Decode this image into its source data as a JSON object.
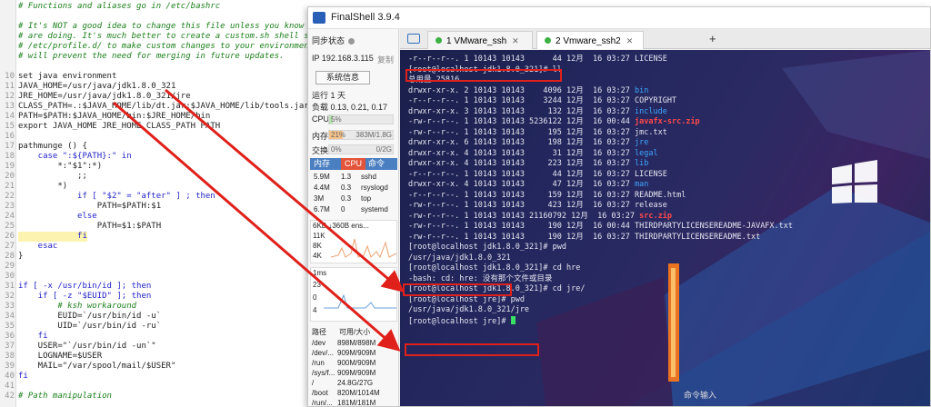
{
  "editor": {
    "lines": [
      {
        "n": "",
        "text": "# Functions and aliases go in /etc/bashrc",
        "cls": "comment"
      },
      {
        "n": "",
        "text": "",
        "cls": ""
      },
      {
        "n": "",
        "text": "# It's NOT a good idea to change this file unless you know what y",
        "cls": "comment"
      },
      {
        "n": "",
        "text": "# are doing. It's much better to create a custom.sh shell script",
        "cls": "comment"
      },
      {
        "n": "",
        "text": "# /etc/profile.d/ to make custom changes to your environment, as",
        "cls": "comment"
      },
      {
        "n": "",
        "text": "# will prevent the need for merging in future updates.",
        "cls": "comment"
      },
      {
        "n": "",
        "text": "",
        "cls": ""
      },
      {
        "n": "10",
        "text": "set java environment",
        "cls": ""
      },
      {
        "n": "11",
        "text": "JAVA_HOME=/usr/java/jdk1.8.0_321",
        "cls": ""
      },
      {
        "n": "12",
        "text": "JRE_HOME=/usr/java/jdk1.8.0_321/jre",
        "cls": ""
      },
      {
        "n": "13",
        "text": "CLASS_PATH=.:$JAVA_HOME/lib/dt.jar:$JAVA_HOME/lib/tools.jar:$JRE_",
        "cls": ""
      },
      {
        "n": "14",
        "text": "PATH=$PATH:$JAVA_HOME/bin:$JRE_HOME/bin",
        "cls": ""
      },
      {
        "n": "15",
        "text": "export JAVA_HOME JRE_HOME CLASS_PATH PATH",
        "cls": ""
      },
      {
        "n": "16",
        "text": "",
        "cls": ""
      },
      {
        "n": "17",
        "text": "pathmunge () {",
        "cls": ""
      },
      {
        "n": "18",
        "text": "    case \":${PATH}:\" in",
        "cls": "kw"
      },
      {
        "n": "19",
        "text": "        *:\"$1\":*)",
        "cls": ""
      },
      {
        "n": "20",
        "text": "            ;;",
        "cls": ""
      },
      {
        "n": "21",
        "text": "        *)",
        "cls": ""
      },
      {
        "n": "22",
        "text": "            if [ \"$2\" = \"after\" ] ; then",
        "cls": "kw"
      },
      {
        "n": "23",
        "text": "                PATH=$PATH:$1",
        "cls": ""
      },
      {
        "n": "24",
        "text": "            else",
        "cls": "kw"
      },
      {
        "n": "25",
        "text": "                PATH=$1:$PATH",
        "cls": ""
      },
      {
        "n": "26",
        "text": "            fi",
        "cls": "kw hl"
      },
      {
        "n": "27",
        "text": "    esac",
        "cls": "kw"
      },
      {
        "n": "28",
        "text": "}",
        "cls": ""
      },
      {
        "n": "29",
        "text": "",
        "cls": ""
      },
      {
        "n": "30",
        "text": "",
        "cls": ""
      },
      {
        "n": "31",
        "text": "if [ -x /usr/bin/id ]; then",
        "cls": "kw"
      },
      {
        "n": "32",
        "text": "    if [ -z \"$EUID\" ]; then",
        "cls": "kw"
      },
      {
        "n": "33",
        "text": "        # ksh workaround",
        "cls": "comment"
      },
      {
        "n": "34",
        "text": "        EUID=`/usr/bin/id -u`",
        "cls": ""
      },
      {
        "n": "35",
        "text": "        UID=`/usr/bin/id -ru`",
        "cls": ""
      },
      {
        "n": "36",
        "text": "    fi",
        "cls": "kw"
      },
      {
        "n": "37",
        "text": "    USER=\"`/usr/bin/id -un`\"",
        "cls": ""
      },
      {
        "n": "38",
        "text": "    LOGNAME=$USER",
        "cls": ""
      },
      {
        "n": "39",
        "text": "    MAIL=\"/var/spool/mail/$USER\"",
        "cls": ""
      },
      {
        "n": "40",
        "text": "fi",
        "cls": "kw"
      },
      {
        "n": "41",
        "text": "",
        "cls": ""
      },
      {
        "n": "42",
        "text": "# Path manipulation",
        "cls": "comment"
      }
    ]
  },
  "finalshell": {
    "title": "FinalShell 3.9.4",
    "sync_status": "同步状态",
    "ip_label": "IP 192.168.3.115",
    "copy_label": "复制",
    "sys_info_button": "系统信息",
    "uptime": "运行 1 天",
    "load": "负载 0.13, 0.21, 0.17",
    "cpu": {
      "label": "CPU",
      "value": "5%",
      "percent": 5
    },
    "mem": {
      "label": "内存",
      "value": "21%",
      "detail": "383M/1.8G",
      "percent": 21
    },
    "swap": {
      "label": "交换",
      "value": "0%",
      "detail": "0/2G",
      "percent": 0
    },
    "process_headers": [
      "内存",
      "CPU",
      "命令"
    ],
    "processes": [
      [
        "5.9M",
        "1.3",
        "sshd"
      ],
      [
        "4.4M",
        "0.3",
        "rsyslogd"
      ],
      [
        "3M",
        "0.3",
        "top"
      ],
      [
        "6.7M",
        "0",
        "systemd"
      ]
    ],
    "net_label": "6KB ↓360B ens...",
    "net_ticks": [
      "11K",
      "8K",
      "4K"
    ],
    "latency_label": "1ms",
    "latency_ticks": [
      "23",
      "0",
      "4"
    ],
    "disk_headers": [
      "路径",
      "可用/大小"
    ],
    "disks": [
      [
        "/dev",
        "898M/898M"
      ],
      [
        "/dev/...",
        "909M/909M"
      ],
      [
        "/run",
        "900M/909M"
      ],
      [
        "/sys/f...",
        "909M/909M"
      ],
      [
        "/",
        "24.8G/27G"
      ],
      [
        "/boot",
        "820M/1014M"
      ],
      [
        "/run/...",
        "181M/181M"
      ]
    ],
    "tabs": [
      {
        "label": "1 VMware_ssh",
        "active": false
      },
      {
        "label": "2 Vmware_ssh2",
        "active": true
      }
    ],
    "add_tab": "+",
    "command_input": "命令输入"
  },
  "terminal": {
    "lines": [
      [
        {
          "t": "-r--r--r--. 1 10143 10143      44 12月  16 03:27 LICENSE",
          "c": "p"
        }
      ],
      [
        {
          "t": "[root@localhost jdk1.8.0_321]# ll",
          "c": "p"
        }
      ],
      [
        {
          "t": "总用量 25816",
          "c": "p"
        }
      ],
      [
        {
          "t": "drwxr-xr-x. 2 10143 10143    4096 12月  16 03:27 ",
          "c": "p"
        },
        {
          "t": "bin",
          "c": "b"
        }
      ],
      [
        {
          "t": "-r--r--r--. 1 10143 10143    3244 12月  16 03:27 COPYRIGHT",
          "c": "p"
        }
      ],
      [
        {
          "t": "drwxr-xr-x. 3 10143 10143     132 12月  16 03:27 ",
          "c": "p"
        },
        {
          "t": "include",
          "c": "b"
        }
      ],
      [
        {
          "t": "-rw-r--r--. 1 10143 10143 5236122 12月  16 00:44 ",
          "c": "p"
        },
        {
          "t": "javafx-src.zip",
          "c": "r"
        }
      ],
      [
        {
          "t": "-rw-r--r--. 1 10143 10143     195 12月  16 03:27 jmc.txt",
          "c": "p"
        }
      ],
      [
        {
          "t": "drwxr-xr-x. 6 10143 10143     198 12月  16 03:27 ",
          "c": "p"
        },
        {
          "t": "jre",
          "c": "b"
        }
      ],
      [
        {
          "t": "drwxr-xr-x. 4 10143 10143      31 12月  16 03:27 ",
          "c": "p"
        },
        {
          "t": "legal",
          "c": "b"
        }
      ],
      [
        {
          "t": "drwxr-xr-x. 4 10143 10143     223 12月  16 03:27 ",
          "c": "p"
        },
        {
          "t": "lib",
          "c": "b"
        }
      ],
      [
        {
          "t": "-r--r--r--. 1 10143 10143      44 12月  16 03:27 LICENSE",
          "c": "p"
        }
      ],
      [
        {
          "t": "drwxr-xr-x. 4 10143 10143      47 12月  16 03:27 ",
          "c": "p"
        },
        {
          "t": "man",
          "c": "b"
        }
      ],
      [
        {
          "t": "-r--r--r--. 1 10143 10143     159 12月  16 03:27 README.html",
          "c": "p"
        }
      ],
      [
        {
          "t": "-rw-r--r--. 1 10143 10143     423 12月  16 03:27 release",
          "c": "p"
        }
      ],
      [
        {
          "t": "-rw-r--r--. 1 10143 10143 21160792 12月  16 03:27 ",
          "c": "p"
        },
        {
          "t": "src.zip",
          "c": "r"
        }
      ],
      [
        {
          "t": "-rw-r--r--. 1 10143 10143     190 12月  16 00:44 THIRDPARTYLICENSEREADME-JAVAFX.txt",
          "c": "p"
        }
      ],
      [
        {
          "t": "-rw-r--r--. 1 10143 10143     190 12月  16 03:27 THIRDPARTYLICENSEREADME.txt",
          "c": "p"
        }
      ],
      [
        {
          "t": "[root@localhost jdk1.8.0_321]# pwd",
          "c": "p"
        }
      ],
      [
        {
          "t": "/usr/java/jdk1.8.0_321",
          "c": "p"
        }
      ],
      [
        {
          "t": "[root@localhost jdk1.8.0_321]# cd hre",
          "c": "p"
        }
      ],
      [
        {
          "t": "-bash: cd: hre: 没有那个文件或目录",
          "c": "p"
        }
      ],
      [
        {
          "t": "[root@localhost jdk1.8.0_321]# cd jre/",
          "c": "p"
        }
      ],
      [
        {
          "t": "[root@localhost jre]# pwd",
          "c": "p"
        }
      ],
      [
        {
          "t": "/usr/java/jdk1.8.0_321/jre",
          "c": "p"
        }
      ],
      [
        {
          "t": "[root@localhost jre]# ",
          "c": "p"
        }
      ]
    ]
  },
  "colors": {
    "annotation_red": "#e0201a",
    "dir_blue": "#3ea7ff",
    "archive_red": "#ff4a4a",
    "cursor_green": "#39e065",
    "accent_blue": "#4a7fc1"
  }
}
